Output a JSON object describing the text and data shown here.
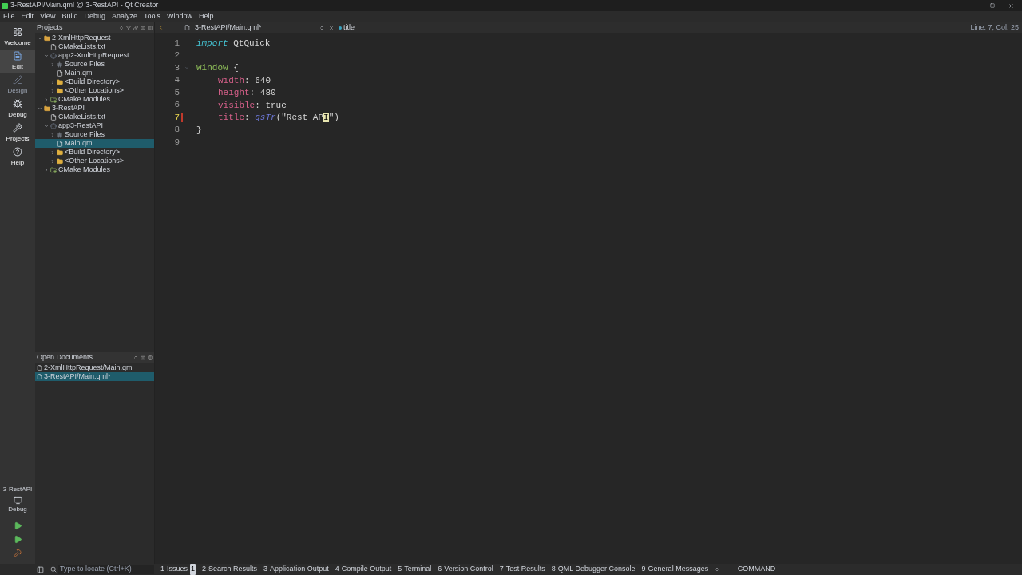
{
  "window": {
    "title": "3-RestAPI/Main.qml @ 3-RestAPI - Qt Creator"
  },
  "menu": [
    "File",
    "Edit",
    "View",
    "Build",
    "Debug",
    "Analyze",
    "Tools",
    "Window",
    "Help"
  ],
  "modes": [
    {
      "label": "Welcome",
      "kind": "welcome",
      "selected": false,
      "disabled": false
    },
    {
      "label": "Edit",
      "kind": "edit",
      "selected": true,
      "disabled": false
    },
    {
      "label": "Design",
      "kind": "design",
      "selected": false,
      "disabled": true
    },
    {
      "label": "Debug",
      "kind": "debug",
      "selected": false,
      "disabled": false
    },
    {
      "label": "Projects",
      "kind": "projects",
      "selected": false,
      "disabled": false
    },
    {
      "label": "Help",
      "kind": "help",
      "selected": false,
      "disabled": false
    }
  ],
  "kit": {
    "project": "3-RestAPI",
    "build": "Debug"
  },
  "projects": {
    "title": "Projects",
    "tree": [
      {
        "label": "2-XmlHttpRequest",
        "kind": "project",
        "expanded": true,
        "selected": false,
        "children": [
          {
            "label": "CMakeLists.txt",
            "kind": "cmake",
            "selected": false
          },
          {
            "label": "app2-XmlHttpRequest",
            "kind": "target",
            "expanded": true,
            "selected": false,
            "children": [
              {
                "label": "Source Files",
                "kind": "sources",
                "expanded": false,
                "selected": false
              },
              {
                "label": "Main.qml",
                "kind": "file",
                "selected": false
              },
              {
                "label": "<Build Directory>",
                "kind": "folder",
                "expanded": false,
                "selected": false
              },
              {
                "label": "<Other Locations>",
                "kind": "folder",
                "expanded": false,
                "selected": false
              }
            ]
          },
          {
            "label": "CMake Modules",
            "kind": "modules",
            "expanded": false,
            "selected": false
          }
        ]
      },
      {
        "label": "3-RestAPI",
        "kind": "project",
        "expanded": true,
        "selected": false,
        "children": [
          {
            "label": "CMakeLists.txt",
            "kind": "cmake",
            "selected": false
          },
          {
            "label": "app3-RestAPI",
            "kind": "target",
            "expanded": true,
            "selected": false,
            "children": [
              {
                "label": "Source Files",
                "kind": "sources",
                "expanded": false,
                "selected": false
              },
              {
                "label": "Main.qml",
                "kind": "file",
                "selected": true
              },
              {
                "label": "<Build Directory>",
                "kind": "folder",
                "expanded": false,
                "selected": false
              },
              {
                "label": "<Other Locations>",
                "kind": "folder",
                "expanded": false,
                "selected": false
              }
            ]
          },
          {
            "label": "CMake Modules",
            "kind": "modules",
            "expanded": false,
            "selected": false
          }
        ]
      }
    ]
  },
  "open_documents": {
    "title": "Open Documents",
    "items": [
      {
        "label": "2-XmlHttpRequest/Main.qml",
        "selected": false
      },
      {
        "label": "3-RestAPI/Main.qml*",
        "selected": true
      }
    ]
  },
  "editor": {
    "file": "3-RestAPI/Main.qml*",
    "symbol": "title",
    "position": "Line: 7, Col: 25",
    "lines": [
      {
        "number": "1",
        "current": false,
        "tokens": [
          {
            "kind": "keyword",
            "text": "import"
          },
          {
            "kind": "plain",
            "text": " QtQuick"
          }
        ]
      },
      {
        "number": "2",
        "current": false
      },
      {
        "number": "3",
        "current": false,
        "fold": true,
        "tokens": [
          {
            "kind": "type",
            "text": "Window"
          },
          {
            "kind": "plain",
            "text": " {"
          }
        ]
      },
      {
        "number": "4",
        "current": false,
        "indented": true,
        "tokens": [
          {
            "kind": "property",
            "text": "width"
          },
          {
            "kind": "plain",
            "text": ": 640"
          }
        ]
      },
      {
        "number": "5",
        "current": false,
        "indented": true,
        "tokens": [
          {
            "kind": "property",
            "text": "height"
          },
          {
            "kind": "plain",
            "text": ": 480"
          }
        ]
      },
      {
        "number": "6",
        "current": false,
        "indented": true,
        "tokens": [
          {
            "kind": "property",
            "text": "visible"
          },
          {
            "kind": "plain",
            "text": ": true"
          }
        ]
      },
      {
        "number": "7",
        "current": true,
        "indented": true,
        "tokens": [
          {
            "kind": "property",
            "text": "title"
          },
          {
            "kind": "plain",
            "text": ": "
          },
          {
            "kind": "function",
            "text": "qsTr"
          },
          {
            "kind": "plain",
            "text": "(\"Rest AP"
          },
          {
            "kind": "cursor",
            "text": "I"
          },
          {
            "kind": "plain",
            "text": "\")"
          }
        ]
      },
      {
        "number": "8",
        "current": false,
        "tokens": [
          {
            "kind": "plain",
            "text": "}"
          }
        ]
      },
      {
        "number": "9",
        "current": false
      }
    ]
  },
  "locator": {
    "placeholder": "Type to locate (Ctrl+K)"
  },
  "output_panes": [
    {
      "number": "1",
      "label": "Issues",
      "badge": "1"
    },
    {
      "number": "2",
      "label": "Search Results"
    },
    {
      "number": "3",
      "label": "Application Output"
    },
    {
      "number": "4",
      "label": "Compile Output"
    },
    {
      "number": "5",
      "label": "Terminal"
    },
    {
      "number": "6",
      "label": "Version Control"
    },
    {
      "number": "7",
      "label": "Test Results"
    },
    {
      "number": "8",
      "label": "QML Debugger Console"
    },
    {
      "number": "9",
      "label": "General Messages"
    }
  ],
  "vim_mode": "-- COMMAND --"
}
